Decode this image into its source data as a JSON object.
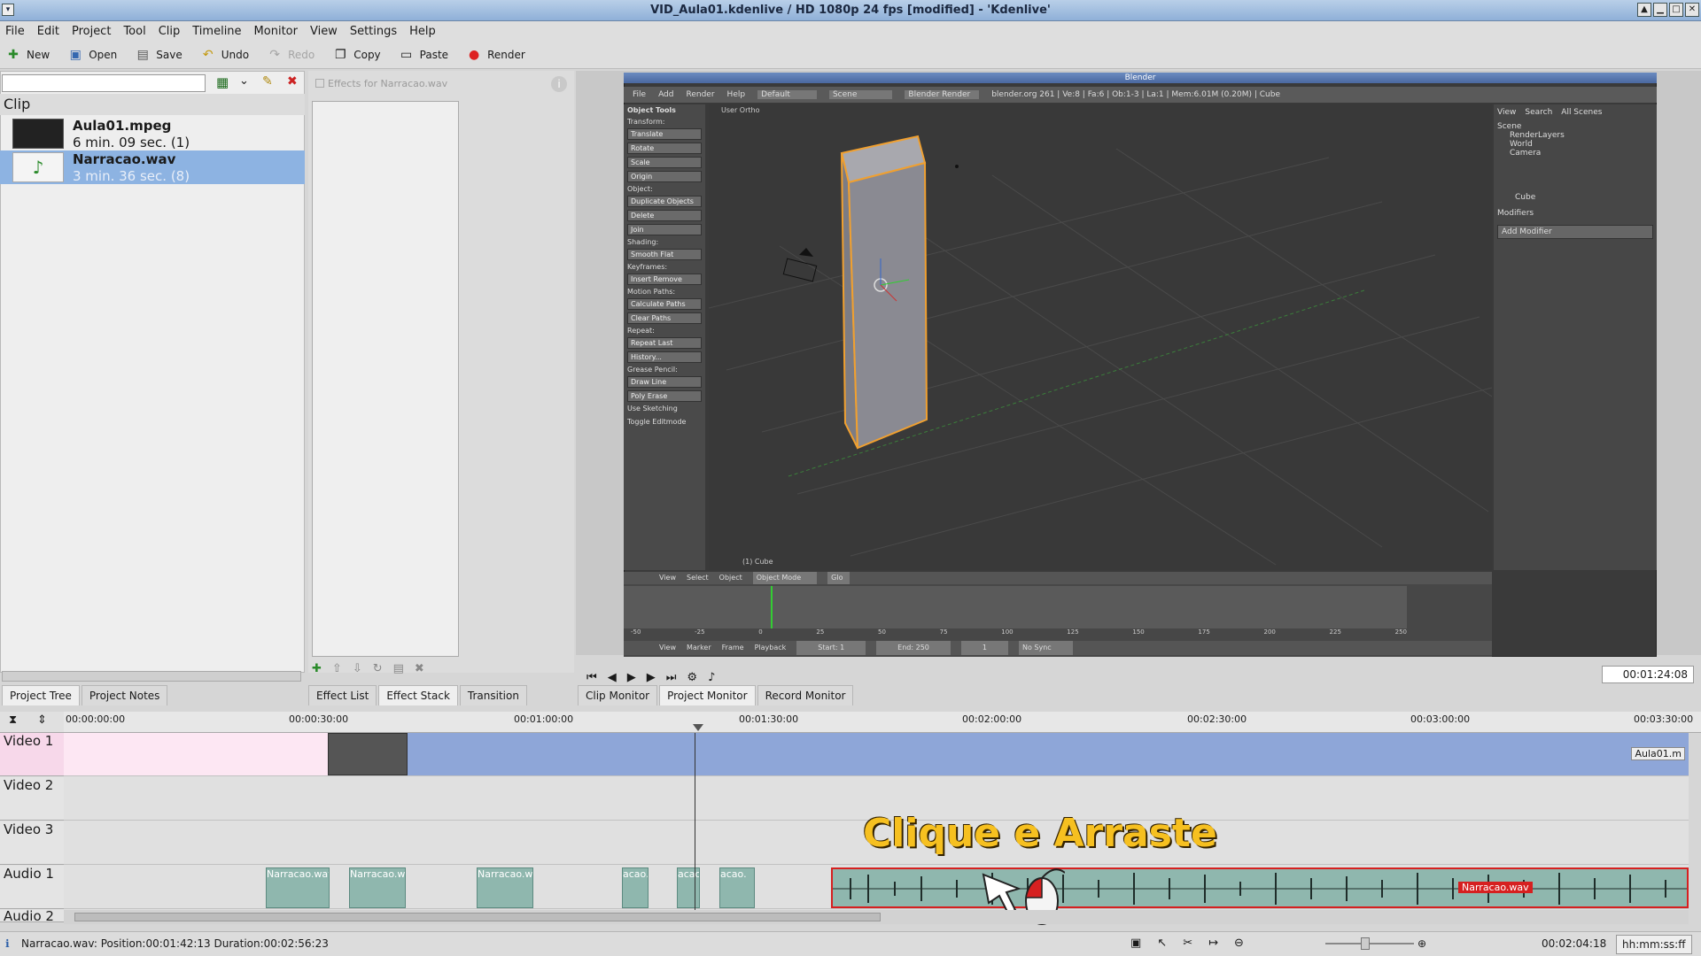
{
  "window": {
    "title": "VID_Aula01.kdenlive / HD 1080p 24 fps [modified] - 'Kdenlive'"
  },
  "menu": [
    "File",
    "Edit",
    "Project",
    "Tool",
    "Clip",
    "Timeline",
    "Monitor",
    "View",
    "Settings",
    "Help"
  ],
  "toolbar": {
    "new": "New",
    "open": "Open",
    "save": "Save",
    "undo": "Undo",
    "redo": "Redo",
    "copy": "Copy",
    "paste": "Paste",
    "render": "Render"
  },
  "bin": {
    "header": "Clip",
    "clips": [
      {
        "name": "Aula01.mpeg",
        "duration": "6 min. 09 sec. (1)"
      },
      {
        "name": "Narracao.wav",
        "duration": "3 min. 36 sec. (8)"
      }
    ],
    "tabs": [
      "Project Tree",
      "Project Notes"
    ]
  },
  "effects": {
    "title": "Effects for Narracao.wav",
    "tabs": [
      "Effect List",
      "Effect Stack",
      "Transition"
    ]
  },
  "blender": {
    "title": "Blender",
    "menu": [
      "File",
      "Add",
      "Render",
      "Help"
    ],
    "layout": "Default",
    "scene": "Scene",
    "engine": "Blender Render",
    "info": "blender.org 261 | Ve:8 | Fa:6 | Ob:1-3 | La:1 | Mem:6.01M (0.20M) | Cube",
    "view_label": "User Ortho",
    "object_label": "(1) Cube",
    "tools_header": "Object Tools",
    "tools": [
      {
        "section": "Transform:",
        "buttons": [
          "Translate",
          "Rotate",
          "Scale",
          "Origin"
        ]
      },
      {
        "section": "Object:",
        "buttons": [
          "Duplicate Objects",
          "Delete",
          "Join"
        ]
      },
      {
        "section": "Shading:",
        "buttons": [
          "Smooth   Flat"
        ]
      },
      {
        "section": "Keyframes:",
        "buttons": [
          "Insert     Remove"
        ]
      },
      {
        "section": "Motion Paths:",
        "buttons": [
          "Calculate Paths",
          "Clear Paths"
        ]
      },
      {
        "section": "Repeat:",
        "buttons": [
          "Repeat Last",
          "History..."
        ]
      },
      {
        "section": "Grease Pencil:",
        "buttons": [
          "Draw    Line",
          "Poly    Erase"
        ]
      }
    ],
    "use_sketching": "Use Sketching",
    "toggle_editmode": "Toggle Editmode",
    "outliner": {
      "tabs": [
        "View",
        "Search",
        "All Scenes"
      ],
      "items": [
        "Scene",
        "RenderLayers",
        "World",
        "Camera"
      ]
    },
    "modifiers": {
      "object": "Cube",
      "header": "Modifiers",
      "add": "Add Modifier"
    },
    "view3d_footer": {
      "menus": [
        "View",
        "Select",
        "Object"
      ],
      "mode": "Object Mode",
      "pivot": "Glo"
    },
    "timeline_footer": {
      "menus": [
        "View",
        "Marker",
        "Frame",
        "Playback"
      ],
      "start": "Start: 1",
      "end": "End: 250",
      "frame": "1",
      "sync": "No Sync"
    },
    "frame_ticks": [
      "-50",
      "-25",
      "0",
      "25",
      "50",
      "75",
      "100",
      "125",
      "150",
      "175",
      "200",
      "225",
      "250"
    ]
  },
  "monitor": {
    "tabs": [
      "Clip Monitor",
      "Project Monitor",
      "Record Monitor"
    ],
    "timecode": "00:01:24:08"
  },
  "timeline": {
    "ruler": [
      "00:00:00:00",
      "00:00:30:00",
      "00:01:00:00",
      "00:01:30:00",
      "00:02:00:00",
      "00:02:30:00",
      "00:03:00:00",
      "00:03:30:00"
    ],
    "tracks": [
      "Video 1",
      "Video 2",
      "Video 3",
      "Audio 1",
      "Audio 2"
    ],
    "video_clip_label": "Aula01.m",
    "audio_clips": [
      "Narracao.wav",
      "Narracao.wa",
      "Narracao.wa",
      "acao.",
      "acao",
      "acao."
    ],
    "selected_clip_label": "Narracao.wav",
    "overlay": "Clique e Arraste"
  },
  "status": {
    "text": "Narracao.wav: Position:00:01:42:13 Duration:00:02:56:23",
    "duration": "00:02:04:18",
    "format": "hh:mm:ss:ff"
  },
  "colors": {
    "accent": "#8fb0d8",
    "video_track": "#8ea6d8",
    "audio_clip": "#8fb7ae",
    "selection": "#d62020",
    "overlay": "#f6c020"
  }
}
